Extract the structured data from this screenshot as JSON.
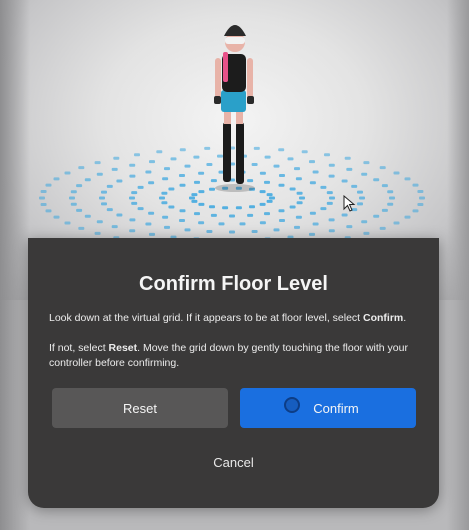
{
  "dialog": {
    "title": "Confirm Floor Level",
    "paragraph1": {
      "before": "Look down at the virtual grid. If it appears to be at floor level, select ",
      "emph": "Confirm",
      "after": "."
    },
    "paragraph2": {
      "before": "If not, select ",
      "emph": "Reset",
      "after": ". Move the grid down by gently touching the floor with your controller before confirming."
    },
    "buttons": {
      "reset": "Reset",
      "confirm": "Confirm",
      "cancel": "Cancel"
    }
  },
  "colors": {
    "dialog_bg": "#3a3939",
    "reset_bg": "#585757",
    "confirm_bg": "#1a6fe0",
    "grid": "#3aa6df"
  },
  "icons": {
    "avatar": "vr-avatar",
    "grid": "floor-grid",
    "pointer": "mouse-pointer-icon",
    "focus": "selection-ring-icon"
  }
}
